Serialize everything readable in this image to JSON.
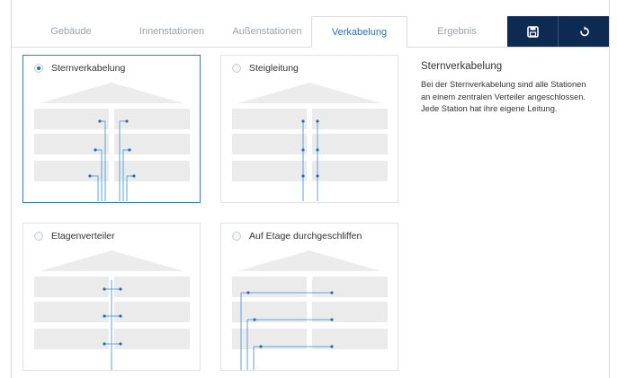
{
  "tabs": [
    {
      "label": "Gebäude",
      "active": false
    },
    {
      "label": "Innenstationen",
      "active": false
    },
    {
      "label": "Außenstationen",
      "active": false
    },
    {
      "label": "Verkabelung",
      "active": true
    },
    {
      "label": "Ergebnis",
      "active": false
    }
  ],
  "toolbar": {
    "save_icon": "save-icon",
    "reset_icon": "undo-icon"
  },
  "options": [
    {
      "label": "Sternverkabelung",
      "selected": true,
      "wiring": "star"
    },
    {
      "label": "Steigleitung",
      "selected": false,
      "wiring": "riser"
    },
    {
      "label": "Etagenverteiler",
      "selected": false,
      "wiring": "floor-distributor"
    },
    {
      "label": "Auf Etage durchgeschliffen",
      "selected": false,
      "wiring": "daisy-chain"
    }
  ],
  "info": {
    "title": "Sternverkabelung",
    "text": "Bei der Sternverkabelung sind alle Stationen an einem zentralen Verteiler angeschlossen. Jede Station hat ihre eigene Leitung."
  },
  "colors": {
    "accent": "#2d6fad",
    "toolbar_bg": "#0d2b52",
    "wire": "#5aa3e0",
    "selected_border": "#3a78c2"
  }
}
